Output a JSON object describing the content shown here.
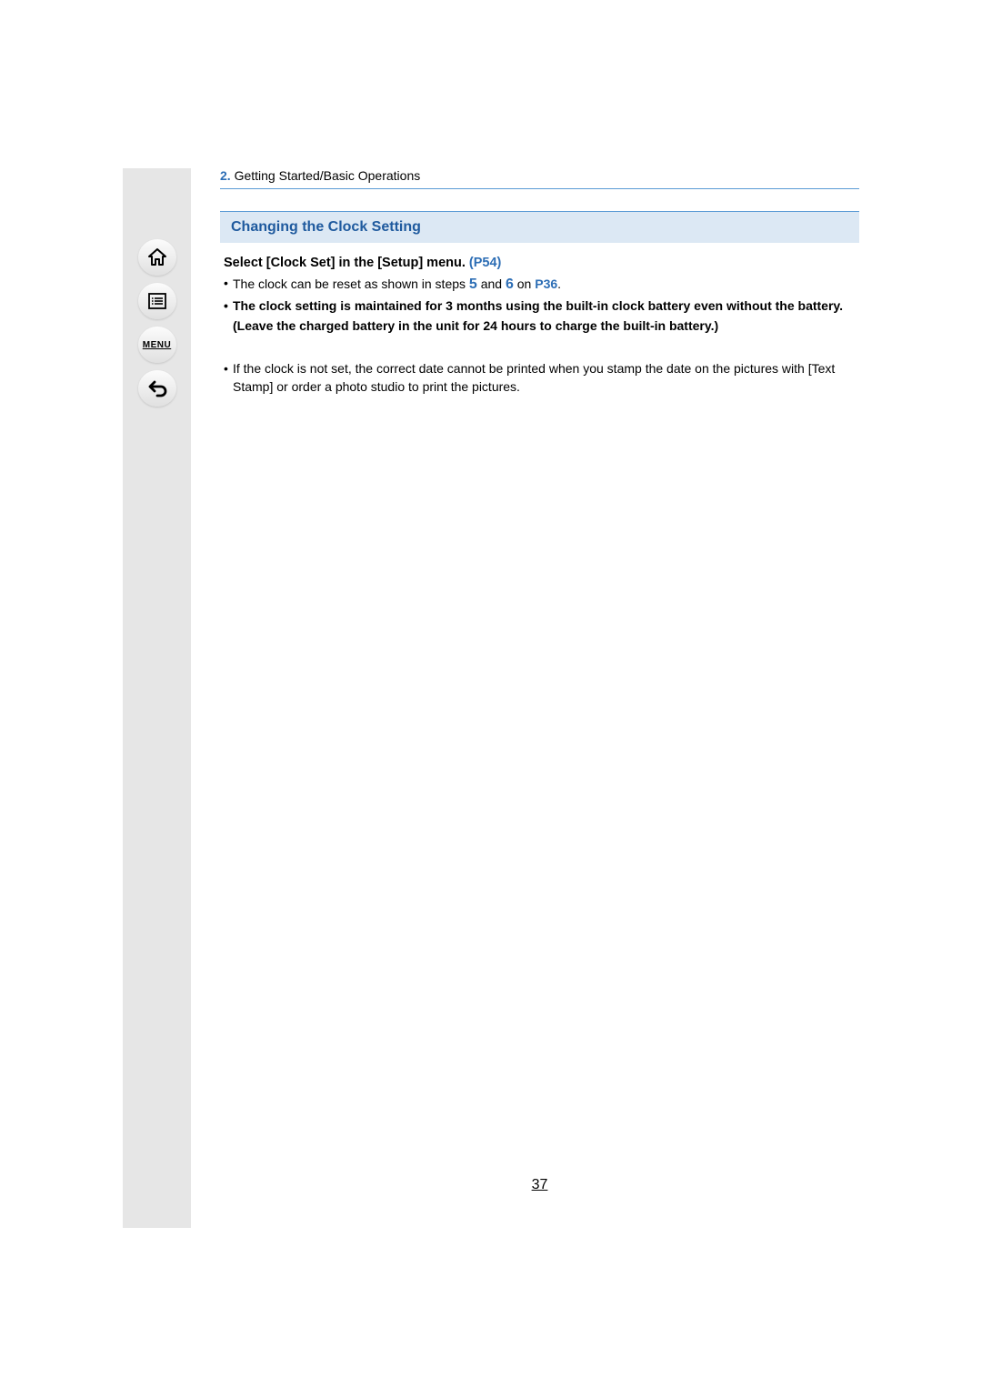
{
  "nav": {
    "home": "home-icon",
    "toc": "toc-icon",
    "menu_label": "MENU",
    "back": "back-icon"
  },
  "chapter": {
    "number": "2.",
    "title": "Getting Started/Basic Operations"
  },
  "section": {
    "title": "Changing the Clock Setting"
  },
  "instruction": {
    "prefix": "Select [Clock Set] in the [Setup] menu. ",
    "link": "(P54)"
  },
  "bullets": {
    "b1_pre": "The clock can be reset as shown in steps ",
    "b1_step1": "5",
    "b1_mid": " and ",
    "b1_step2": "6",
    "b1_on": " on ",
    "b1_link": "P36",
    "b1_end": ".",
    "b2": "The clock setting is maintained for 3 months using the built-in clock battery even without the battery.",
    "b2_continue": "(Leave the charged battery in the unit for 24 hours to charge the built-in battery.)",
    "note1": "If the clock is not set, the correct date cannot be printed when you stamp the date on the pictures with [Text Stamp] or order a photo studio to print the pictures."
  },
  "page_number": "37"
}
